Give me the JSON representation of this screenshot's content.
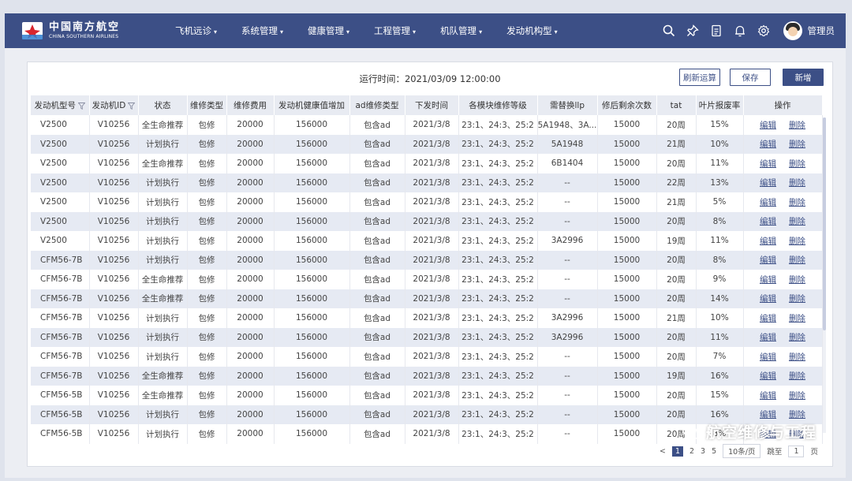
{
  "header": {
    "logo_cn": "中国南方航空",
    "logo_en": "CHINA SOUTHERN AIRLINES",
    "nav": [
      "飞机远诊",
      "系统管理",
      "健康管理",
      "工程管理",
      "机队管理",
      "发动机构型"
    ],
    "caret": "▾",
    "user": "管理员",
    "icons": [
      "search-icon",
      "pin-icon",
      "document-icon",
      "bell-icon",
      "gear-icon"
    ]
  },
  "toolbar": {
    "run_time": "运行时间：2021/03/09 12:00:00",
    "refresh_label": "刷新运算",
    "save_label": "保存",
    "add_label": "新增"
  },
  "table": {
    "columns": [
      "发动机型号",
      "发动机ID",
      "状态",
      "维修类型",
      "维修费用",
      "发动机健康值增加",
      "ad维修类型",
      "下发时间",
      "各模块维修等级",
      "需替换llp",
      "修后剩余次数",
      "tat",
      "叶片报废率",
      "操作"
    ],
    "actions": {
      "edit": "编辑",
      "delete": "删除"
    },
    "rows": [
      [
        "V2500",
        "V10256",
        "全生命推荐",
        "包修",
        "20000",
        "156000",
        "包含ad",
        "2021/3/8",
        "23:1、24:3、25:2",
        "5A1948、3A...",
        "15000",
        "20周",
        "15%"
      ],
      [
        "V2500",
        "V10256",
        "计划执行",
        "包修",
        "20000",
        "156000",
        "包含ad",
        "2021/3/8",
        "23:1、24:3、25:2",
        "5A1948",
        "15000",
        "21周",
        "10%"
      ],
      [
        "V2500",
        "V10256",
        "全生命推荐",
        "包修",
        "20000",
        "156000",
        "包含ad",
        "2021/3/8",
        "23:1、24:3、25:2",
        "6B1404",
        "15000",
        "20周",
        "11%"
      ],
      [
        "V2500",
        "V10256",
        "计划执行",
        "包修",
        "20000",
        "156000",
        "包含ad",
        "2021/3/8",
        "23:1、24:3、25:2",
        "--",
        "15000",
        "22周",
        "13%"
      ],
      [
        "V2500",
        "V10256",
        "计划执行",
        "包修",
        "20000",
        "156000",
        "包含ad",
        "2021/3/8",
        "23:1、24:3、25:2",
        "--",
        "15000",
        "21周",
        "5%"
      ],
      [
        "V2500",
        "V10256",
        "计划执行",
        "包修",
        "20000",
        "156000",
        "包含ad",
        "2021/3/8",
        "23:1、24:3、25:2",
        "--",
        "15000",
        "20周",
        "8%"
      ],
      [
        "V2500",
        "V10256",
        "计划执行",
        "包修",
        "20000",
        "156000",
        "包含ad",
        "2021/3/8",
        "23:1、24:3、25:2",
        "3A2996",
        "15000",
        "19周",
        "11%"
      ],
      [
        "CFM56-7B",
        "V10256",
        "计划执行",
        "包修",
        "20000",
        "156000",
        "包含ad",
        "2021/3/8",
        "23:1、24:3、25:2",
        "--",
        "15000",
        "20周",
        "8%"
      ],
      [
        "CFM56-7B",
        "V10256",
        "全生命推荐",
        "包修",
        "20000",
        "156000",
        "包含ad",
        "2021/3/8",
        "23:1、24:3、25:2",
        "--",
        "15000",
        "20周",
        "9%"
      ],
      [
        "CFM56-7B",
        "V10256",
        "全生命推荐",
        "包修",
        "20000",
        "156000",
        "包含ad",
        "2021/3/8",
        "23:1、24:3、25:2",
        "--",
        "15000",
        "20周",
        "14%"
      ],
      [
        "CFM56-7B",
        "V10256",
        "计划执行",
        "包修",
        "20000",
        "156000",
        "包含ad",
        "2021/3/8",
        "23:1、24:3、25:2",
        "3A2996",
        "15000",
        "21周",
        "10%"
      ],
      [
        "CFM56-7B",
        "V10256",
        "计划执行",
        "包修",
        "20000",
        "156000",
        "包含ad",
        "2021/3/8",
        "23:1、24:3、25:2",
        "3A2996",
        "15000",
        "20周",
        "11%"
      ],
      [
        "CFM56-7B",
        "V10256",
        "计划执行",
        "包修",
        "20000",
        "156000",
        "包含ad",
        "2021/3/8",
        "23:1、24:3、25:2",
        "--",
        "15000",
        "20周",
        "7%"
      ],
      [
        "CFM56-7B",
        "V10256",
        "全生命推荐",
        "包修",
        "20000",
        "156000",
        "包含ad",
        "2021/3/8",
        "23:1、24:3、25:2",
        "--",
        "15000",
        "19周",
        "16%"
      ],
      [
        "CFM56-5B",
        "V10256",
        "全生命推荐",
        "包修",
        "20000",
        "156000",
        "包含ad",
        "2021/3/8",
        "23:1、24:3、25:2",
        "--",
        "15000",
        "20周",
        "15%"
      ],
      [
        "CFM56-5B",
        "V10256",
        "计划执行",
        "包修",
        "20000",
        "156000",
        "包含ad",
        "2021/3/8",
        "23:1、24:3、25:2",
        "--",
        "15000",
        "20周",
        "16%"
      ],
      [
        "CFM56-5B",
        "V10256",
        "计划执行",
        "包修",
        "20000",
        "156000",
        "包含ad",
        "2021/3/8",
        "23:1、24:3、25:2",
        "--",
        "15000",
        "20周",
        "8%"
      ]
    ]
  },
  "pager": {
    "prev": "<",
    "pages": [
      "1",
      "2",
      "3",
      "5"
    ],
    "current": "1",
    "page_size": "10条/页",
    "goto_label": "跳至",
    "goto_value": "1",
    "page_unit": "页"
  },
  "watermark": "航空维修与工程",
  "colors": {
    "brand": "#3c4f86",
    "row_alt": "#e6eaf3",
    "header_bg": "#e8ebf2"
  }
}
